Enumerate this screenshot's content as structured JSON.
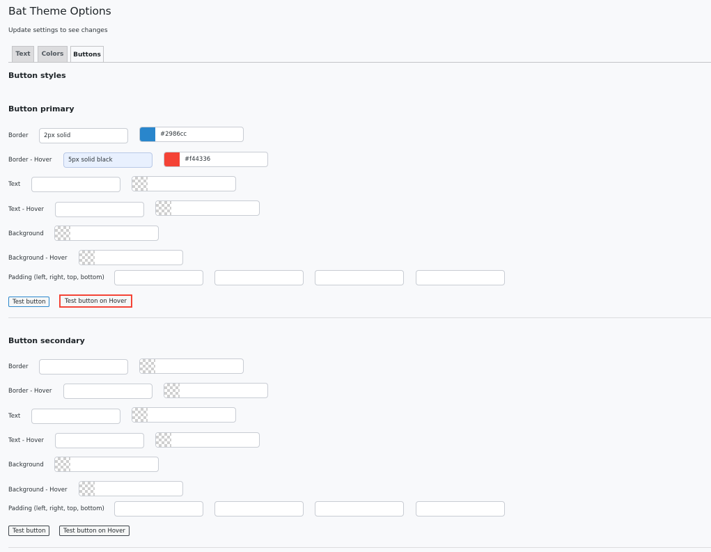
{
  "page": {
    "title": "Bat Theme Options",
    "subtitle": "Update settings to see changes"
  },
  "tabs": [
    {
      "label": "Text",
      "active": false
    },
    {
      "label": "Colors",
      "active": false
    },
    {
      "label": "Buttons",
      "active": true
    }
  ],
  "button_styles_heading": "Button styles",
  "primary": {
    "title": "Button primary",
    "labels": {
      "border": "Border",
      "border_hover": "Border - Hover",
      "text": "Text",
      "text_hover": "Text - Hover",
      "background": "Background",
      "background_hover": "Background - Hover",
      "padding": "Padding (left, right, top, bottom)"
    },
    "border_value": "2px solid",
    "border_color": "#2986cc",
    "border_hover_value": "5px solid black",
    "border_hover_color": "#f44336",
    "test_button": "Test button",
    "test_hover_button": "Test button on Hover"
  },
  "secondary": {
    "title": "Button secondary",
    "labels": {
      "border": "Border",
      "border_hover": "Border - Hover",
      "text": "Text",
      "text_hover": "Text - Hover",
      "background": "Background",
      "background_hover": "Background - Hover",
      "padding": "Padding (left, right, top, bottom)"
    },
    "test_button": "Test button",
    "test_hover_button": "Test button on Hover"
  },
  "colors": {
    "primary_swatch": "#2986cc",
    "hover_swatch": "#f44336",
    "hover_outline": "#f44336"
  },
  "icons": {
    "empty_color": "transparent-checker-icon"
  }
}
